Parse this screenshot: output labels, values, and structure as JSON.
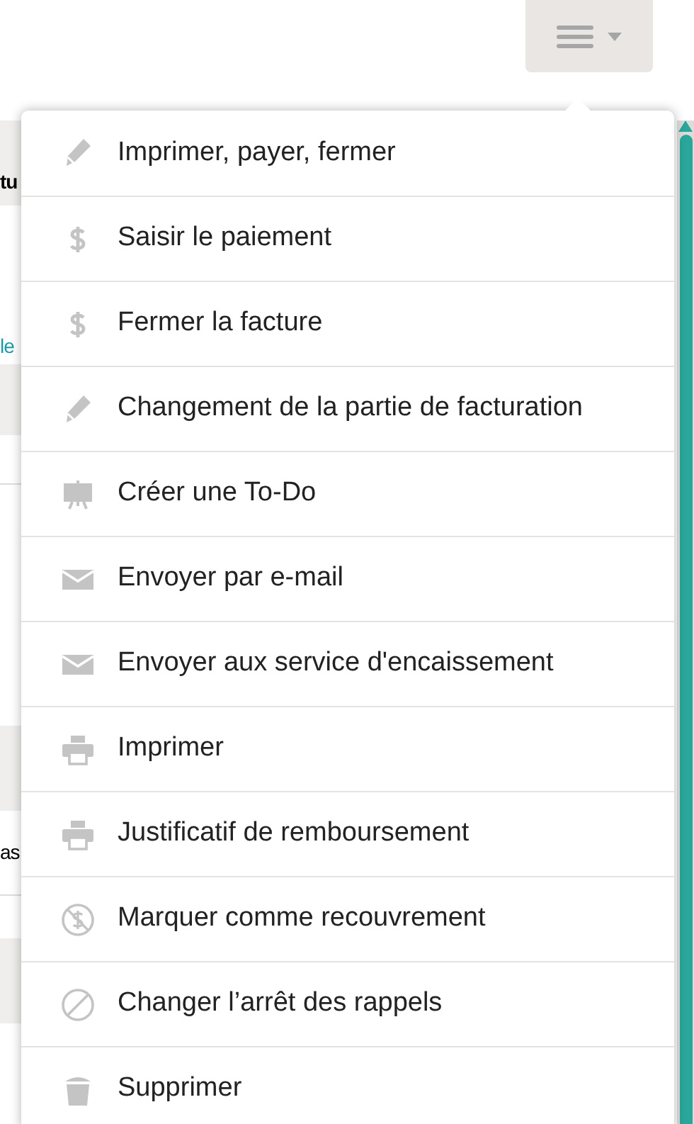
{
  "background": {
    "fragments": [
      {
        "text": "tu",
        "kind": "heading"
      },
      {
        "text": "le",
        "kind": "link"
      },
      {
        "text": "as",
        "kind": "plain"
      }
    ]
  },
  "menu_button": {
    "expanded": true
  },
  "menu": {
    "items": [
      {
        "label": "Imprimer, payer, fermer",
        "kind": "pencil"
      },
      {
        "label": "Saisir le paiement",
        "kind": "dollar"
      },
      {
        "label": "Fermer la facture",
        "kind": "dollar"
      },
      {
        "label": "Changement de la partie de facturation",
        "kind": "pencil"
      },
      {
        "label": "Créer une To-Do",
        "kind": "easel"
      },
      {
        "label": "Envoyer par e-mail",
        "kind": "envelope"
      },
      {
        "label": "Envoyer aux service d'encaissement",
        "kind": "envelope"
      },
      {
        "label": "Imprimer",
        "kind": "printer"
      },
      {
        "label": "Justificatif de remboursement",
        "kind": "printer"
      },
      {
        "label": "Marquer comme recouvrement",
        "kind": "nodollar"
      },
      {
        "label": "Changer l’arrêt des rappels",
        "kind": "ban"
      },
      {
        "label": "Supprimer",
        "kind": "trash"
      }
    ]
  }
}
